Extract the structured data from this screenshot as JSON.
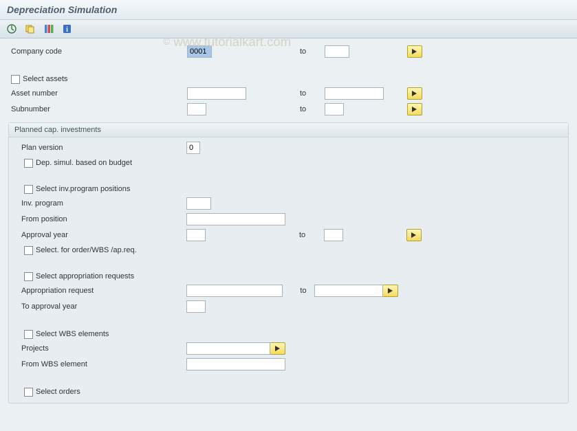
{
  "watermark": "www.tutorialkart.com",
  "title": "Depreciation Simulation",
  "labels": {
    "company_code": "Company code",
    "to": "to",
    "select_assets": "Select assets",
    "asset_number": "Asset number",
    "subnumber": "Subnumber",
    "planned_cap": "Planned cap. investments",
    "plan_version": "Plan version",
    "dep_simul_budget": "Dep. simul. based on budget",
    "select_inv_prog": "Select inv.program positions",
    "inv_program": "Inv. program",
    "from_position": "From position",
    "approval_year": "Approval year",
    "select_order_wbs": "Select. for order/WBS /ap.req.",
    "select_appr_req": "Select appropriation requests",
    "appr_request": "Appropriation request",
    "to_approval_year": "To approval year",
    "select_wbs": "Select WBS elements",
    "projects": "Projects",
    "from_wbs": "From WBS element",
    "select_orders": "Select orders"
  },
  "values": {
    "company_code_from": "0001",
    "company_code_to": "",
    "asset_number_from": "",
    "asset_number_to": "",
    "subnumber_from": "",
    "subnumber_to": "",
    "plan_version": "0",
    "inv_program": "",
    "from_position": "",
    "approval_year_from": "",
    "approval_year_to": "",
    "appr_request_from": "",
    "appr_request_to": "",
    "to_approval_year": "",
    "projects": "",
    "from_wbs": ""
  }
}
